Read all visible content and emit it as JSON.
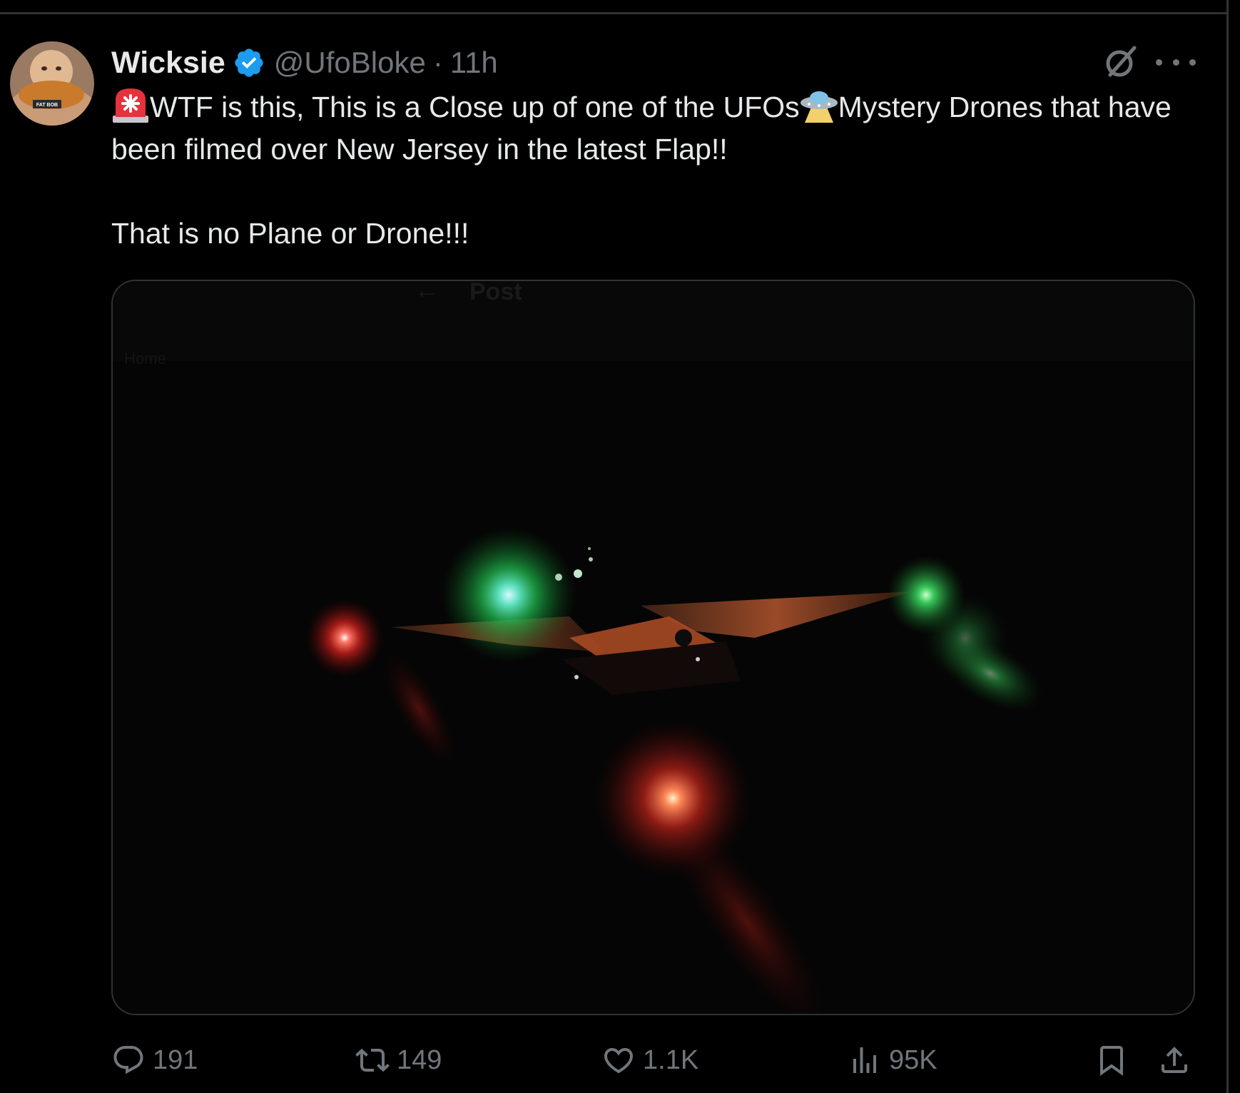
{
  "tweet": {
    "author_name": "Wicksie",
    "handle": "@UfoBloke",
    "separator": "·",
    "time": "11h",
    "avatar_caption": "FAT BOB",
    "text_line1": "WTF is this, This is a Close up of one of the UFOs",
    "text_line1_after": "Mystery Drones that have been filmed over New Jersey in the latest Flap!!",
    "text_line2": "That is no Plane or Drone!!!",
    "emoji_1": "rotating-light-emoji",
    "emoji_2": "flying-saucer-emoji"
  },
  "media": {
    "overlay_back_arrow": "←",
    "overlay_title": "Post",
    "overlay_faint_text": "Home"
  },
  "actions": {
    "replies": "191",
    "reposts": "149",
    "likes": "1.1K",
    "views": "95K"
  },
  "colors": {
    "background": "#000000",
    "text": "#e7e9ea",
    "secondary": "#71767b",
    "verified": "#1d9bf0",
    "border": "#2f3336"
  }
}
